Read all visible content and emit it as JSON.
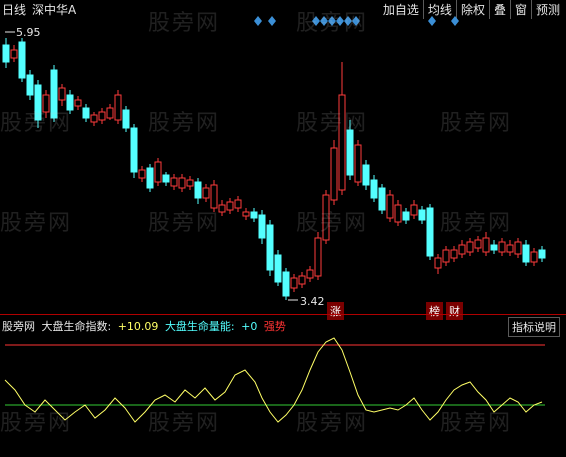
{
  "header": {
    "period": "日线",
    "stock": "深中华A"
  },
  "toolbar": {
    "items": [
      "加自选",
      "均线",
      "除权",
      "叠",
      "窗",
      "预测"
    ]
  },
  "price_labels": {
    "high": "5.95",
    "low": "3.42"
  },
  "tags": {
    "limit_up": "涨",
    "ranking": "榜",
    "finance": "财"
  },
  "indicator": {
    "source": "股旁网",
    "name1": "大盘生命指数:",
    "value1": "+10.09",
    "name2": "大盘生命量能:",
    "value2": "+0",
    "status": "强势",
    "help_label": "指标说明"
  },
  "watermark": "股旁网",
  "colors": {
    "background": "#000000",
    "up_candle": "#ff3c3c",
    "down_candle": "#54ffff",
    "diamond": "#3b8fd6",
    "line": "#ffff66",
    "zero_line": "#33cc33",
    "upper_band": "#ff3333",
    "value1_color": "#ffff66",
    "value2_color": "#54ffff",
    "status_color": "#ff3333"
  }
}
